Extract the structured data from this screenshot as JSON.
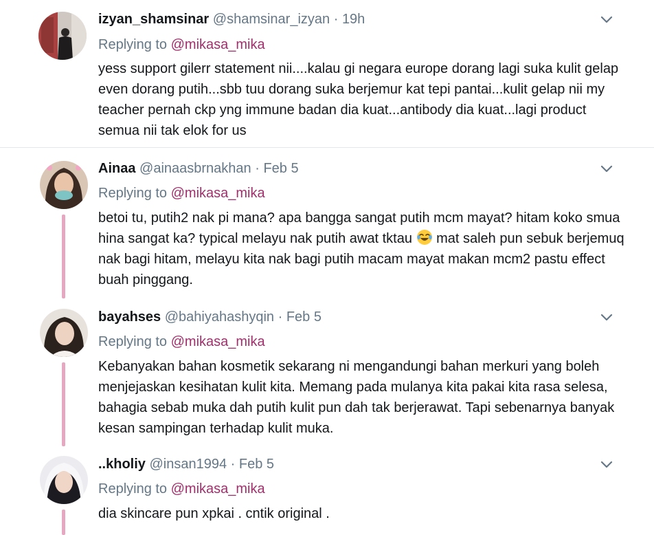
{
  "tweets": [
    {
      "name": "izyan_shamsinar",
      "handle": "@shamsinar_izyan",
      "sep": "·",
      "time": "19h",
      "replying_prefix": "Replying to",
      "replying_to": "@mikasa_mika",
      "text": "yess support gilerr statement nii....kalau gi negara europe dorang lagi suka kulit gelap even dorang putih...sbb tuu dorang suka berjemur kat tepi pantai...kulit gelap nii my teacher pernah ckp yng immune badan dia kuat...antibody dia kuat...lagi product semua nii tak elok for us"
    },
    {
      "name": "Ainaa",
      "handle": "@ainaasbrnakhan",
      "sep": "·",
      "time": "Feb 5",
      "replying_prefix": "Replying to",
      "replying_to": "@mikasa_mika",
      "text_before_emoji": "betoi tu, putih2 nak pi mana? apa bangga sangat putih mcm mayat? hitam koko smua hina sangat ka? typical melayu nak putih awat tktau",
      "emoji": "face-with-tears-of-joy",
      "text_after_emoji": "mat saleh pun sebuk berjemuq nak bagi hitam, melayu kita nak bagi putih macam mayat makan mcm2 pastu effect buah pinggang."
    },
    {
      "name": "bayahses",
      "handle": "@bahiyahashyqin",
      "sep": "·",
      "time": "Feb 5",
      "replying_prefix": "Replying to",
      "replying_to": "@mikasa_mika",
      "text": "Kebanyakan bahan kosmetik sekarang ni mengandungi bahan merkuri yang boleh menjejaskan kesihatan kulit kita. Memang pada mulanya kita pakai kita rasa selesa, bahagia sebab muka dah putih kulit pun dah tak berjerawat. Tapi sebenarnya banyak kesan sampingan terhadap kulit muka."
    },
    {
      "name": "..kholiy",
      "handle": "@insan1994",
      "sep": "·",
      "time": "Feb 5",
      "replying_prefix": "Replying to",
      "replying_to": "@mikasa_mika",
      "text": "dia skincare pun xpkai . cntik original ."
    }
  ],
  "colors": {
    "mention": "#a0306b",
    "muted": "#657786",
    "thread_line": "#e6a7c0",
    "divider": "#e1e8ed"
  }
}
